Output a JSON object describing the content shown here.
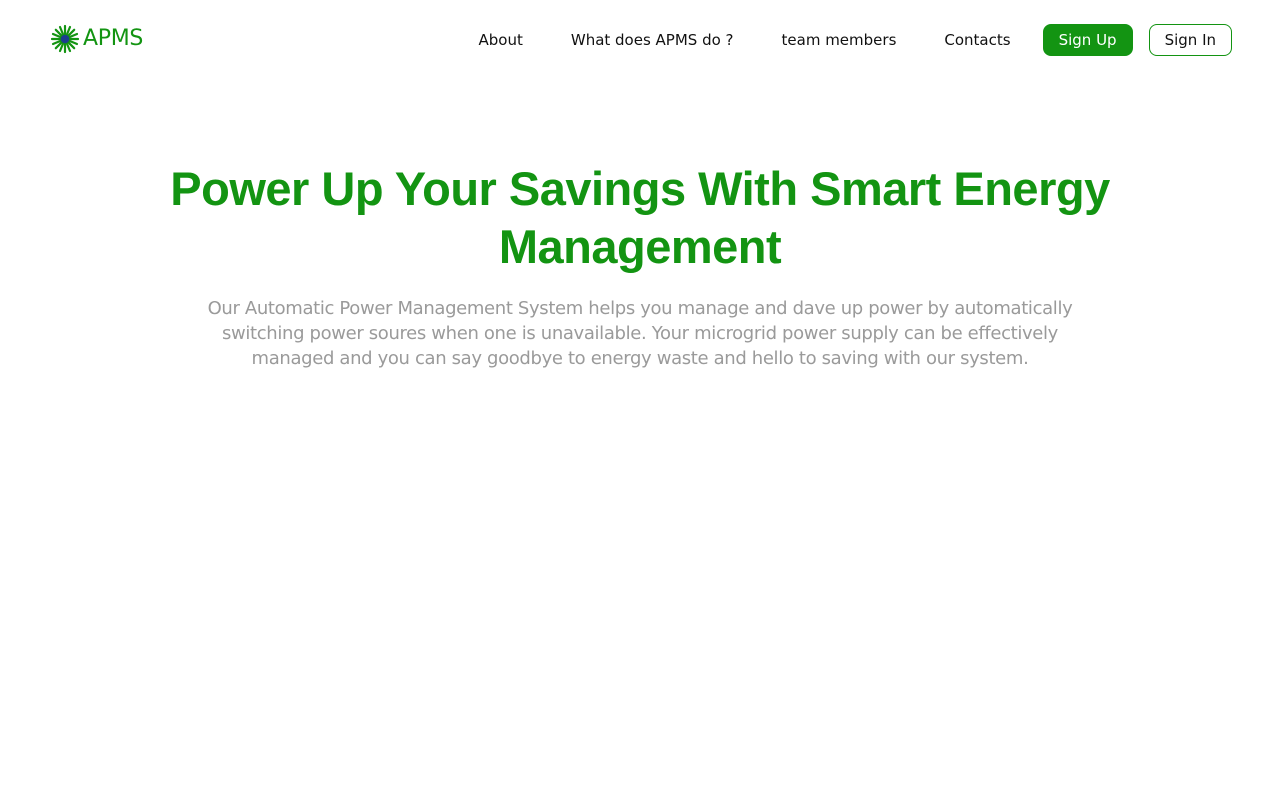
{
  "brand": {
    "name": "APMS",
    "icon": "starburst-icon",
    "color": "#139412",
    "icon_center_color": "#1d3f8f"
  },
  "nav": {
    "links": [
      {
        "label": "About"
      },
      {
        "label": "What does APMS do ?"
      },
      {
        "label": "team members"
      },
      {
        "label": "Contacts"
      }
    ],
    "signup_label": "Sign Up",
    "signin_label": "Sign In"
  },
  "hero": {
    "title": "Power Up Your Savings With Smart Energy Management",
    "description": "Our Automatic Power Management System helps you manage and dave up power by automatically switching power soures when one is unavailable. Your microgrid power supply can be effectively managed and you can say goodbye to energy waste and hello to saving with our system."
  },
  "colors": {
    "accent": "#139412",
    "text": "#111111",
    "muted": "#9a9a9a",
    "background": "#ffffff"
  }
}
